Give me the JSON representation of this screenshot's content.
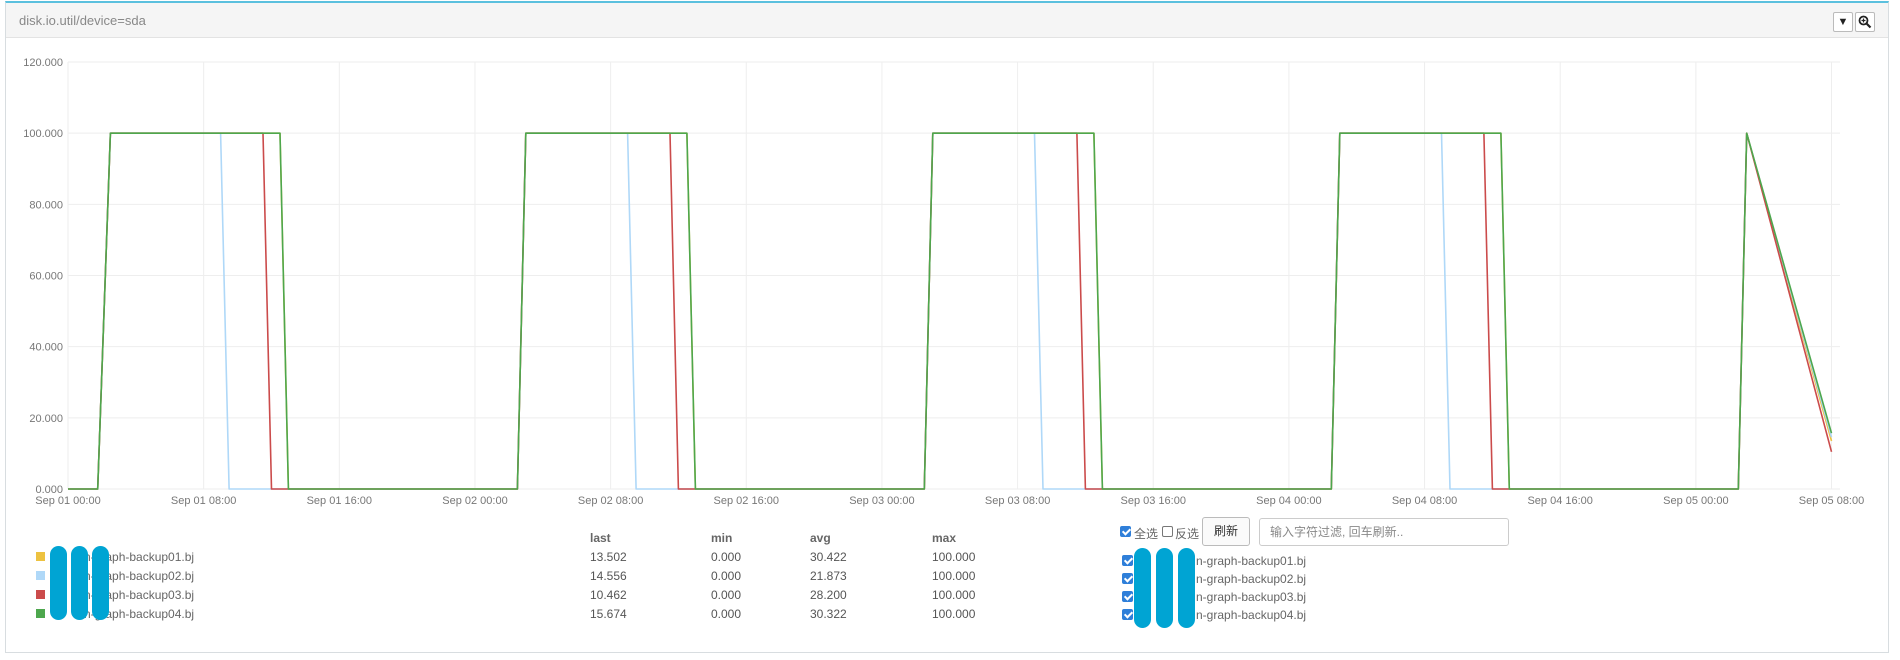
{
  "panel": {
    "title": "disk.io.util/device=sda",
    "dropdown_icon": "caret-down-icon",
    "zoom_icon": "zoom-in-icon"
  },
  "chart_data": {
    "type": "line",
    "ylim": [
      0,
      120
    ],
    "y_ticks": [
      "0.000",
      "20.000",
      "40.000",
      "60.000",
      "80.000",
      "100.000",
      "120.000"
    ],
    "x_range": [
      "Sep 01 00:00",
      "Sep 05 08:30"
    ],
    "x_ticks": [
      {
        "t": "Sep 01 00:00",
        "label": "Sep 01 00:00"
      },
      {
        "t": "Sep 01 08:00",
        "label": "Sep 01 08:00"
      },
      {
        "t": "Sep 01 16:00",
        "label": "Sep 01 16:00"
      },
      {
        "t": "Sep 02 00:00",
        "label": "Sep 02 00:00"
      },
      {
        "t": "Sep 02 08:00",
        "label": "Sep 02 08:00"
      },
      {
        "t": "Sep 02 16:00",
        "label": "Sep 02 16:00"
      },
      {
        "t": "Sep 03 00:00",
        "label": "Sep 03 00:00"
      },
      {
        "t": "Sep 03 08:00",
        "label": "Sep 03 08:00"
      },
      {
        "t": "Sep 03 16:00",
        "label": "Sep 03 16:00"
      },
      {
        "t": "Sep 04 00:00",
        "label": "Sep 04 00:00"
      },
      {
        "t": "Sep 04 08:00",
        "label": "Sep 04 08:00"
      },
      {
        "t": "Sep 04 16:00",
        "label": "Sep 04 16:00"
      },
      {
        "t": "Sep 05 00:00",
        "label": "Sep 05 00:00"
      },
      {
        "t": "Sep 05 08:00",
        "label": "Sep 05 08:00"
      }
    ],
    "grid": true,
    "series": [
      {
        "name": "n-graph-backup01.bj",
        "color": "#edc240",
        "points": [
          [
            "Sep 01 00:00",
            0
          ],
          [
            "Sep 01 01:45",
            0
          ],
          [
            "Sep 01 02:30",
            100
          ],
          [
            "Sep 01 12:30",
            100
          ],
          [
            "Sep 01 13:00",
            0
          ],
          [
            "Sep 02 02:30",
            0
          ],
          [
            "Sep 02 03:00",
            100
          ],
          [
            "Sep 02 12:30",
            100
          ],
          [
            "Sep 02 13:00",
            0
          ],
          [
            "Sep 03 02:30",
            0
          ],
          [
            "Sep 03 03:00",
            100
          ],
          [
            "Sep 03 12:30",
            100
          ],
          [
            "Sep 03 13:00",
            0
          ],
          [
            "Sep 04 02:30",
            0
          ],
          [
            "Sep 04 03:00",
            100
          ],
          [
            "Sep 04 12:30",
            100
          ],
          [
            "Sep 04 13:00",
            0
          ],
          [
            "Sep 05 02:30",
            0
          ],
          [
            "Sep 05 03:00",
            100
          ],
          [
            "Sep 05 08:00",
            13.502
          ]
        ]
      },
      {
        "name": "n-graph-backup02.bj",
        "color": "#afd8f8",
        "points": [
          [
            "Sep 01 00:00",
            0
          ],
          [
            "Sep 01 01:45",
            0
          ],
          [
            "Sep 01 02:30",
            100
          ],
          [
            "Sep 01 09:00",
            100
          ],
          [
            "Sep 01 09:30",
            0
          ],
          [
            "Sep 02 02:30",
            0
          ],
          [
            "Sep 02 03:00",
            100
          ],
          [
            "Sep 02 09:00",
            100
          ],
          [
            "Sep 02 09:30",
            0
          ],
          [
            "Sep 03 02:30",
            0
          ],
          [
            "Sep 03 03:00",
            100
          ],
          [
            "Sep 03 09:00",
            100
          ],
          [
            "Sep 03 09:30",
            0
          ],
          [
            "Sep 04 02:30",
            0
          ],
          [
            "Sep 04 03:00",
            100
          ],
          [
            "Sep 04 09:00",
            100
          ],
          [
            "Sep 04 09:30",
            0
          ],
          [
            "Sep 05 02:30",
            0
          ],
          [
            "Sep 05 03:00",
            100
          ],
          [
            "Sep 05 08:00",
            14.556
          ]
        ]
      },
      {
        "name": "n-graph-backup03.bj",
        "color": "#cb4b4b",
        "points": [
          [
            "Sep 01 00:00",
            0
          ],
          [
            "Sep 01 01:45",
            0
          ],
          [
            "Sep 01 02:30",
            100
          ],
          [
            "Sep 01 11:30",
            100
          ],
          [
            "Sep 01 12:00",
            0
          ],
          [
            "Sep 02 02:30",
            0
          ],
          [
            "Sep 02 03:00",
            100
          ],
          [
            "Sep 02 11:30",
            100
          ],
          [
            "Sep 02 12:00",
            0
          ],
          [
            "Sep 03 02:30",
            0
          ],
          [
            "Sep 03 03:00",
            100
          ],
          [
            "Sep 03 11:30",
            100
          ],
          [
            "Sep 03 12:00",
            0
          ],
          [
            "Sep 04 02:30",
            0
          ],
          [
            "Sep 04 03:00",
            100
          ],
          [
            "Sep 04 11:30",
            100
          ],
          [
            "Sep 04 12:00",
            0
          ],
          [
            "Sep 05 02:30",
            0
          ],
          [
            "Sep 05 03:00",
            100
          ],
          [
            "Sep 05 08:00",
            10.462
          ]
        ]
      },
      {
        "name": "n-graph-backup04.bj",
        "color": "#4da74d",
        "points": [
          [
            "Sep 01 00:00",
            0
          ],
          [
            "Sep 01 01:45",
            0
          ],
          [
            "Sep 01 02:30",
            100
          ],
          [
            "Sep 01 12:30",
            100
          ],
          [
            "Sep 01 13:00",
            0
          ],
          [
            "Sep 02 02:30",
            0
          ],
          [
            "Sep 02 03:00",
            100
          ],
          [
            "Sep 02 12:30",
            100
          ],
          [
            "Sep 02 13:00",
            0
          ],
          [
            "Sep 03 02:30",
            0
          ],
          [
            "Sep 03 03:00",
            100
          ],
          [
            "Sep 03 12:30",
            100
          ],
          [
            "Sep 03 13:00",
            0
          ],
          [
            "Sep 04 02:30",
            0
          ],
          [
            "Sep 04 03:00",
            100
          ],
          [
            "Sep 04 12:30",
            100
          ],
          [
            "Sep 04 13:00",
            0
          ],
          [
            "Sep 05 02:30",
            0
          ],
          [
            "Sep 05 03:00",
            100
          ],
          [
            "Sep 05 08:00",
            15.674
          ]
        ]
      }
    ]
  },
  "legend": {
    "columns": [
      "last",
      "min",
      "avg",
      "max"
    ],
    "rows": [
      {
        "name": "n-graph-backup01.bj",
        "color": "#edc240",
        "last": "13.502",
        "min": "0.000",
        "avg": "30.422",
        "max": "100.000"
      },
      {
        "name": "n-graph-backup02.bj",
        "color": "#afd8f8",
        "last": "14.556",
        "min": "0.000",
        "avg": "21.873",
        "max": "100.000"
      },
      {
        "name": "n-graph-backup03.bj",
        "color": "#cb4b4b",
        "last": "10.462",
        "min": "0.000",
        "avg": "28.200",
        "max": "100.000"
      },
      {
        "name": "n-graph-backup04.bj",
        "color": "#4da74d",
        "last": "15.674",
        "min": "0.000",
        "avg": "30.322",
        "max": "100.000"
      }
    ]
  },
  "controls": {
    "select_all_label": "全选",
    "invert_label": "反选",
    "refresh_label": "刷新",
    "filter_placeholder": "输入字符过滤, 回车刷新..",
    "filter_value": ""
  },
  "filter_list": [
    {
      "name": "n-graph-backup01.bj",
      "checked": true
    },
    {
      "name": "n-graph-backup02.bj",
      "checked": true
    },
    {
      "name": "n-graph-backup03.bj",
      "checked": true
    },
    {
      "name": "n-graph-backup04.bj",
      "checked": true
    }
  ]
}
